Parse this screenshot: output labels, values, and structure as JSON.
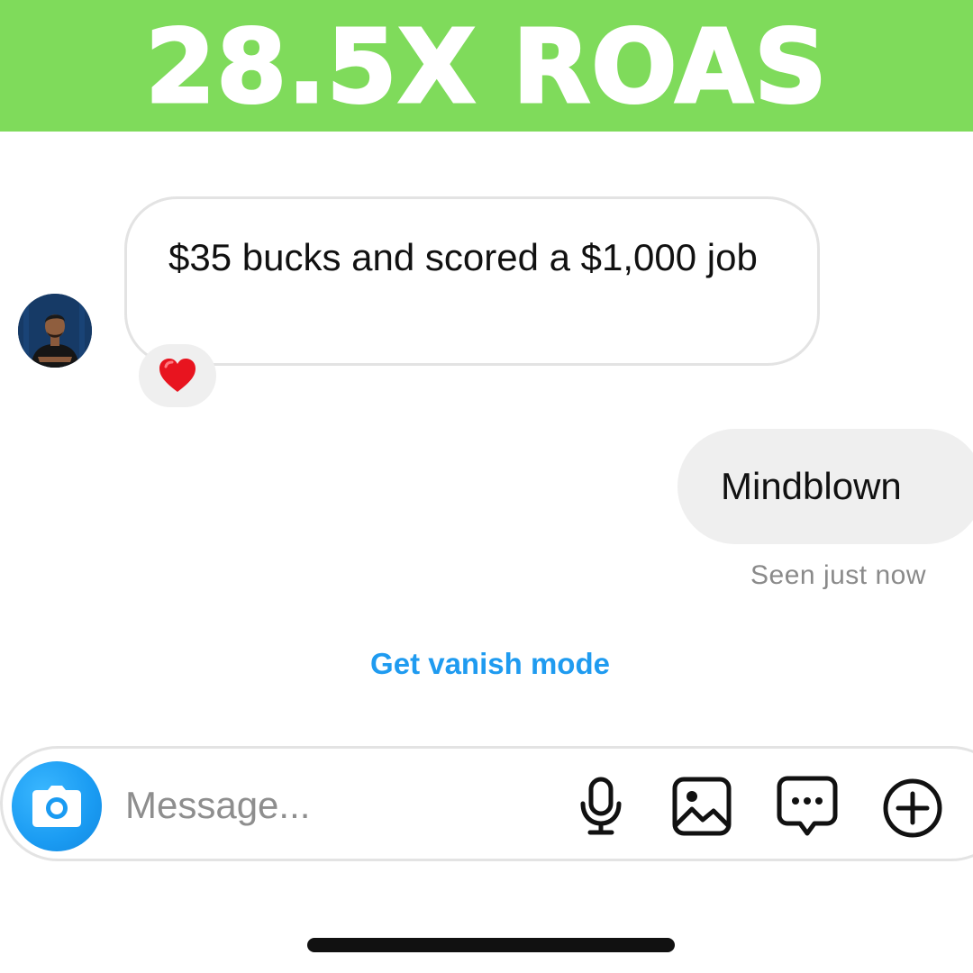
{
  "banner": {
    "title": "28.5X ROAS",
    "background_color": "#7fdb5b"
  },
  "conversation": {
    "incoming": {
      "avatar_icon": "profile-photo",
      "text": "$35 bucks and scored a $1,000 job",
      "reaction_icon": "red-heart-icon"
    },
    "outgoing": {
      "text": "Mindblown",
      "status": "Seen just now"
    },
    "vanish_mode_link": "Get vanish mode"
  },
  "composer": {
    "placeholder": "Message...",
    "camera_icon": "camera-icon",
    "mic_icon": "microphone-icon",
    "gallery_icon": "image-icon",
    "sticker_icon": "chat-bubble-icon",
    "more_icon": "plus-circle-icon"
  },
  "colors": {
    "accent": "#1f9bf0",
    "bubble_gray": "#efefef"
  }
}
